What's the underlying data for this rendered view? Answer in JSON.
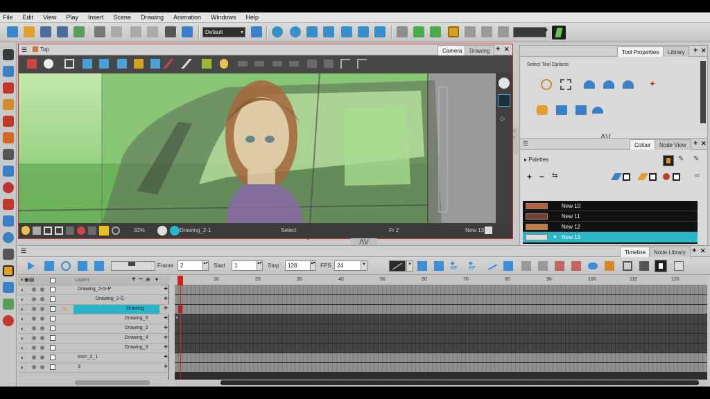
{
  "menu": [
    "File",
    "Edit",
    "View",
    "Play",
    "Insert",
    "Scene",
    "Drawing",
    "Animation",
    "Windows",
    "Help"
  ],
  "toolbar": {
    "workspace": "Default"
  },
  "camera_view": {
    "breadcrumb": "Top",
    "tabs": [
      "Camera",
      "Drawing"
    ],
    "status": {
      "zoom": "32%",
      "drawing": "Drawing_2-1",
      "mode": "Select",
      "frame": "Fr 2",
      "colour": "New 13"
    }
  },
  "tool_properties": {
    "tabs": [
      "Tool Properties",
      "Library"
    ],
    "heading": "Select Tool Options"
  },
  "colour": {
    "tabs": [
      "Colour",
      "Node View"
    ],
    "palettes_label": "Palettes",
    "swatches": [
      {
        "name": "New 10",
        "color": "#b5603a"
      },
      {
        "name": "New 11",
        "color": "#7a3e2e"
      },
      {
        "name": "New 12",
        "color": "#c97a3c"
      },
      {
        "name": "New 13",
        "color": "#dcdcdc"
      }
    ],
    "selected": "New 13",
    "selected_color": "#29b6c6"
  },
  "timeline": {
    "tabs": [
      "Timeline",
      "Node Library"
    ],
    "frame_label": "Frame",
    "frame": "2",
    "start_label": "Start",
    "start": "1",
    "stop_label": "Stop",
    "stop": "128",
    "fps_label": "FPS",
    "fps": "24",
    "layers_label": "Layers",
    "ruler": [
      "10",
      "20",
      "30",
      "40",
      "50",
      "60",
      "70",
      "80",
      "90",
      "100",
      "110",
      "120"
    ],
    "layers": [
      {
        "name": "Drawing_2-G-P",
        "indent": 1
      },
      {
        "name": "Drawing_2-G",
        "indent": 2
      },
      {
        "name": "Drawing",
        "indent": 3,
        "selected": true
      },
      {
        "name": "Drawing_5",
        "indent": 4
      },
      {
        "name": "Drawing_2",
        "indent": 4
      },
      {
        "name": "Drawing_4",
        "indent": 4
      },
      {
        "name": "Drawing_3",
        "indent": 4
      },
      {
        "name": "toon_2_1",
        "indent": 1
      },
      {
        "name": "3",
        "indent": 1
      }
    ]
  }
}
